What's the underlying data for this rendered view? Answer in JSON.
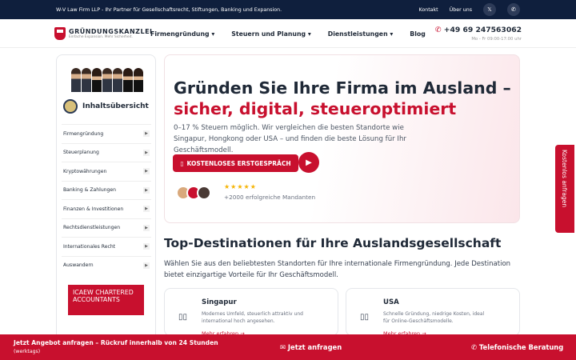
{
  "topbar": {
    "text": "W-V Law Firm LLP - Ihr Partner für Gesellschaftsrecht, Stiftungen, Banking und Expansion.",
    "contact": "Kontakt",
    "about": "Über uns",
    "social": [
      {
        "icon": "x-icon",
        "glyph": "𝕏"
      },
      {
        "icon": "whatsapp-icon",
        "glyph": "✆"
      }
    ]
  },
  "nav": {
    "logo_title": "GRÜNDUNGSKANZLEI",
    "logo_sub": "Einfache Expansion. Mehr Sicherheit.",
    "menu": [
      "Firmengründung",
      "Steuern und Planung",
      "Dienstleistungen",
      "Blog"
    ],
    "phone": "+49 69 247563062",
    "hours": "Mo - Fr 09:00-17:00 uhr"
  },
  "sidebar": {
    "title": "Inhaltsübersicht",
    "items": [
      "Firmengründung",
      "Steuerplanung",
      "Kryptowährungen",
      "Banking & Zahlungen",
      "Finanzen & Investitionen",
      "Rechtsdienstleistungen",
      "Internationales Recht",
      "Auswandern"
    ],
    "badge_text": "ICAEW CHARTERED ACCOUNTANTS"
  },
  "hero": {
    "title_line1": "Gründen Sie Ihre Firma im Ausland –",
    "title_line2": "sicher, digital, steueroptimiert",
    "description": "0–17 % Steuern möglich. Wir vergleichen die besten Standorte wie Singapur, Hongkong oder USA – und finden die beste Lösung für Ihr Geschäftsmodell.",
    "cta": "KOSTENLOSES ERSTGESPRÄCH",
    "stars": "★★★★★",
    "clients": "+2000 erfolgreiche Mandanten"
  },
  "destinations": {
    "title": "Top-Destinationen für Ihre Auslandsgesellschaft",
    "description": "Wählen Sie aus den beliebtesten Standorten für Ihre internationale Firmengründung. Jede Destination bietet einzigartige Vorteile für Ihr Geschäftsmodell.",
    "cards": [
      {
        "name": "Singapur",
        "desc": "Modernes Umfeld, steuerlich attraktiv und international hoch angesehen.",
        "more": "Mehr erfahren →"
      },
      {
        "name": "USA",
        "desc": "Schnelle Gründung, niedrige Kosten, ideal für Online-Geschäftsmodelle.",
        "more": "Mehr erfahren →"
      }
    ]
  },
  "side_tab": "Kostenlos anfragen",
  "bottombar": {
    "line1": "Jetzt Angebot anfragen – Rückruf innerhalb von 24 Stunden",
    "line2": "(werktags)",
    "mid": "✉ Jetzt anfragen",
    "right": "✆ Telefonische Beratung"
  },
  "colors": {
    "brand": "#c8102e",
    "topbar": "#0f1f3d"
  }
}
